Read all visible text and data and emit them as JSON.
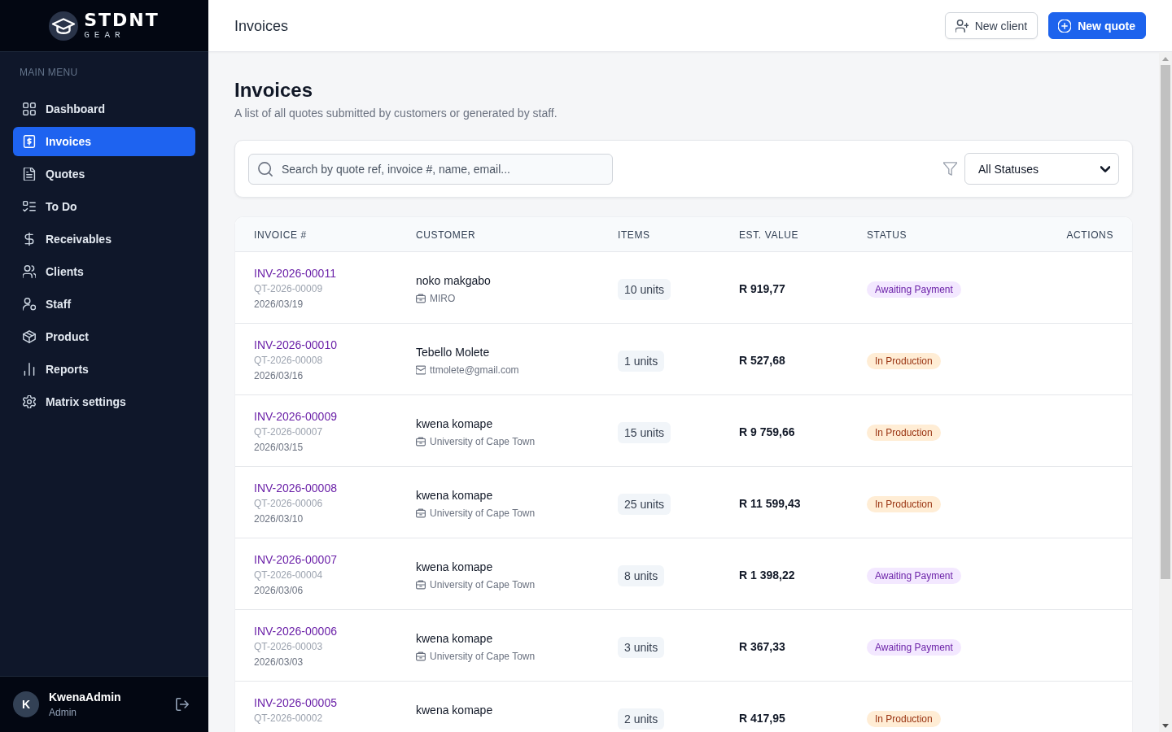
{
  "sidebar": {
    "logo": {
      "title": "STDNT",
      "subtitle": "GEAR"
    },
    "section_label": "MAIN MENU",
    "items": [
      {
        "label": "Dashboard",
        "selected": false
      },
      {
        "label": "Invoices",
        "selected": true
      },
      {
        "label": "Quotes",
        "selected": false
      },
      {
        "label": "To Do",
        "selected": false
      },
      {
        "label": "Receivables",
        "selected": false
      },
      {
        "label": "Clients",
        "selected": false
      },
      {
        "label": "Staff",
        "selected": false
      },
      {
        "label": "Product",
        "selected": false
      },
      {
        "label": "Reports",
        "selected": false
      },
      {
        "label": "Matrix settings",
        "selected": false
      }
    ],
    "user": {
      "initial": "K",
      "name": "KwenaAdmin",
      "role": "Admin"
    }
  },
  "header": {
    "title": "Invoices",
    "buttons": [
      {
        "label": "New client",
        "kind": "secondary"
      },
      {
        "label": "New quote",
        "kind": "primary"
      }
    ]
  },
  "page": {
    "title": "Invoices",
    "subtitle": "A list of all quotes submitted by customers or generated by staff."
  },
  "filters": {
    "search": {
      "placeholder": "Search by quote ref, invoice #, name, email..."
    },
    "status_select": {
      "value": "All Statuses"
    }
  },
  "table": {
    "columns": [
      "INVOICE #",
      "CUSTOMER",
      "ITEMS",
      "EST. VALUE",
      "STATUS",
      "ACTIONS"
    ],
    "rows": [
      {
        "invoice": "INV-2026-00011",
        "quote": "QT-2026-00009",
        "date": "2026/03/19",
        "customer": "noko makgabo",
        "detail": {
          "kind": "company",
          "text": "MIRO"
        },
        "items": "10 units",
        "value": "R 919,77",
        "status": {
          "kind": "awaiting_payment",
          "label": "Awaiting Payment"
        }
      },
      {
        "invoice": "INV-2026-00010",
        "quote": "QT-2026-00008",
        "date": "2026/03/16",
        "customer": "Tebello Molete",
        "detail": {
          "kind": "email",
          "text": "ttmolete@gmail.com"
        },
        "items": "1 units",
        "value": "R 527,68",
        "status": {
          "kind": "in_production",
          "label": "In Production"
        }
      },
      {
        "invoice": "INV-2026-00009",
        "quote": "QT-2026-00007",
        "date": "2026/03/15",
        "customer": "kwena komape",
        "detail": {
          "kind": "company",
          "text": "University of Cape Town"
        },
        "items": "15 units",
        "value": "R 9 759,66",
        "status": {
          "kind": "in_production",
          "label": "In Production"
        }
      },
      {
        "invoice": "INV-2026-00008",
        "quote": "QT-2026-00006",
        "date": "2026/03/10",
        "customer": "kwena komape",
        "detail": {
          "kind": "company",
          "text": "University of Cape Town"
        },
        "items": "25 units",
        "value": "R 11 599,43",
        "status": {
          "kind": "in_production",
          "label": "In Production"
        }
      },
      {
        "invoice": "INV-2026-00007",
        "quote": "QT-2026-00004",
        "date": "2026/03/06",
        "customer": "kwena komape",
        "detail": {
          "kind": "company",
          "text": "University of Cape Town"
        },
        "items": "8 units",
        "value": "R 1 398,22",
        "status": {
          "kind": "awaiting_payment",
          "label": "Awaiting Payment"
        }
      },
      {
        "invoice": "INV-2026-00006",
        "quote": "QT-2026-00003",
        "date": "2026/03/03",
        "customer": "kwena komape",
        "detail": {
          "kind": "company",
          "text": "University of Cape Town"
        },
        "items": "3 units",
        "value": "R 367,33",
        "status": {
          "kind": "awaiting_payment",
          "label": "Awaiting Payment"
        }
      },
      {
        "invoice": "INV-2026-00005",
        "quote": "QT-2026-00002",
        "customer": "kwena komape",
        "items": "2 units",
        "value": "R 417,95",
        "status": {
          "kind": "in_production",
          "label": "In Production"
        }
      }
    ]
  }
}
